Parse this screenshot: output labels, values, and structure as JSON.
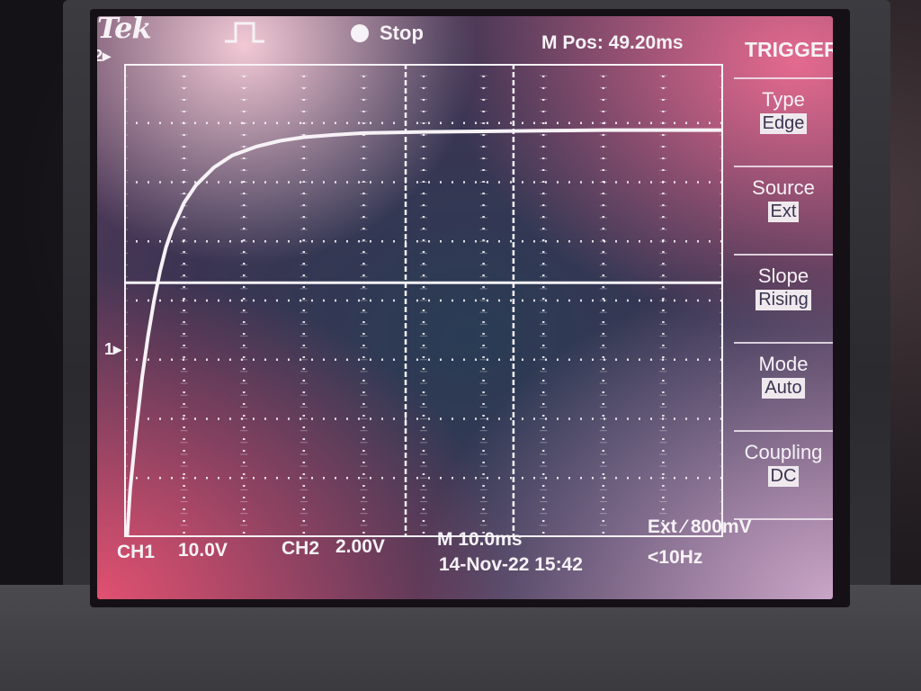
{
  "header": {
    "brand": "Tek",
    "run_state": "Stop",
    "position": "M Pos: 49.20ms"
  },
  "markers": {
    "ch2": "2",
    "ch1": "1"
  },
  "menu": {
    "title": "TRIGGER",
    "items": [
      {
        "label": "Type",
        "value": "Edge"
      },
      {
        "label": "Source",
        "value": "Ext"
      },
      {
        "label": "Slope",
        "value": "Rising"
      },
      {
        "label": "Mode",
        "value": "Auto"
      },
      {
        "label": "Coupling",
        "value": "DC"
      }
    ]
  },
  "footer": {
    "ch1_label": "CH1",
    "ch1_scale": "10.0V",
    "ch2_label": "CH2",
    "ch2_scale": "2.00V",
    "timebase": "M 10.0ms",
    "trigger": "Ext ⁄ 800mV",
    "datetime": "14-Nov-22 15:42",
    "frequency": "<10Hz"
  },
  "colors": {
    "trace": "#f6f2f6",
    "grid": "#f6f2f6"
  },
  "chart_data": {
    "type": "line",
    "x_divisions": 10,
    "y_divisions": 8,
    "cursor_x_div": [
      4.7,
      6.5
    ],
    "cursor_y_div": 3.7,
    "series": [
      {
        "x": [
          0.05,
          0.1,
          0.2,
          0.3,
          0.4,
          0.5,
          0.6,
          0.7,
          0.8,
          1.0,
          1.2,
          1.5,
          1.8,
          2.2,
          2.6,
          3.0,
          3.5,
          4.0,
          5.0,
          6.0,
          7.0,
          8.0,
          9.0,
          10.0
        ],
        "y": [
          0.0,
          0.8,
          1.8,
          2.7,
          3.4,
          4.0,
          4.5,
          4.9,
          5.2,
          5.65,
          5.95,
          6.25,
          6.45,
          6.6,
          6.7,
          6.76,
          6.8,
          6.83,
          6.85,
          6.86,
          6.87,
          6.88,
          6.88,
          6.88
        ]
      }
    ]
  }
}
